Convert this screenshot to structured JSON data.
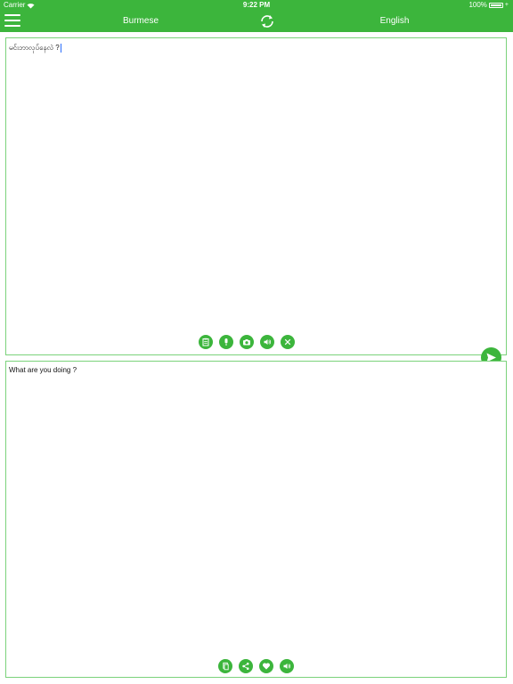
{
  "status_bar": {
    "carrier": "Carrier",
    "time": "9:22 PM",
    "battery": "100%"
  },
  "nav": {
    "source_language": "Burmese",
    "target_language": "English"
  },
  "source": {
    "text": "မင်းဘာလုပ်နေလဲ ?"
  },
  "target": {
    "text": "What are you doing ?"
  },
  "icons": {
    "menu": "hamburger-menu-icon",
    "swap": "swap-languages-icon",
    "source_toolbar": [
      "clipboard-icon",
      "microphone-icon",
      "camera-icon",
      "speaker-icon",
      "clear-icon"
    ],
    "target_toolbar": [
      "copy-icon",
      "share-icon",
      "heart-icon",
      "speaker-icon"
    ],
    "send": "send-icon"
  },
  "colors": {
    "accent": "#3cb53c",
    "border": "#7bd27b"
  }
}
